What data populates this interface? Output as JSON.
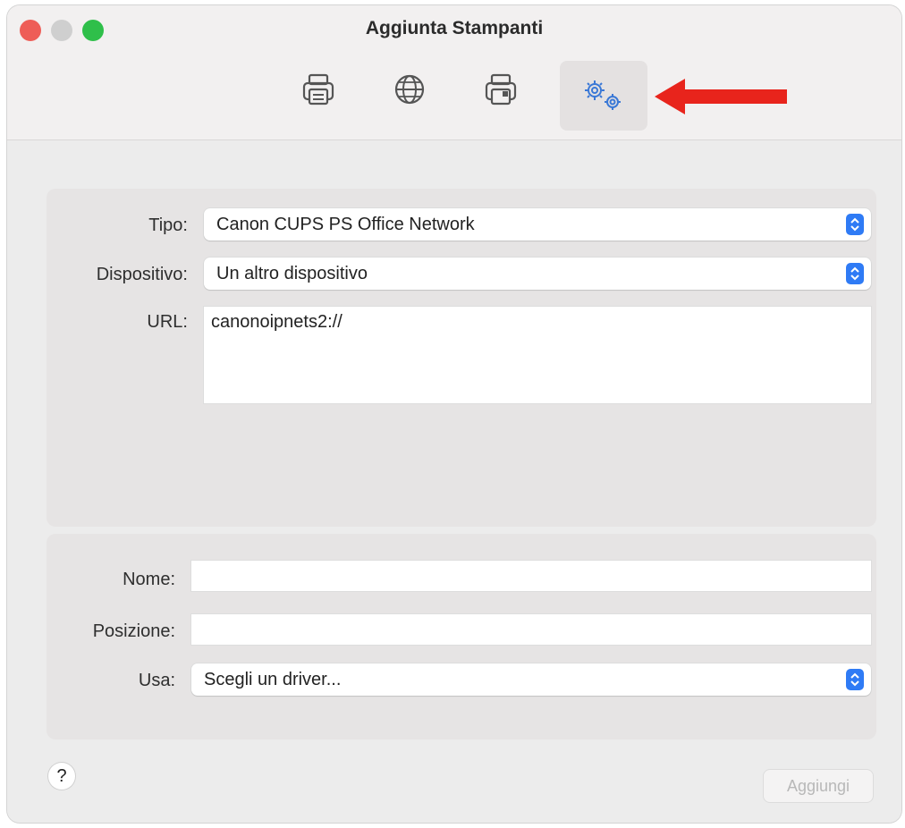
{
  "window": {
    "title": "Aggiunta Stampanti"
  },
  "toolbar": {
    "items": [
      {
        "icon": "printer-icon"
      },
      {
        "icon": "globe-icon"
      },
      {
        "icon": "windows-printer-icon"
      },
      {
        "icon": "gears-icon"
      }
    ],
    "arrow_color": "#e8241c"
  },
  "form": {
    "tipo": {
      "label": "Tipo:",
      "value": "Canon CUPS PS Office Network"
    },
    "dispositivo": {
      "label": "Dispositivo:",
      "value": "Un altro dispositivo"
    },
    "url": {
      "label": "URL:",
      "value": "canonoipnets2://"
    },
    "nome": {
      "label": "Nome:",
      "value": ""
    },
    "posizione": {
      "label": "Posizione:",
      "value": ""
    },
    "usa": {
      "label": "Usa:",
      "value": "Scegli un driver..."
    }
  },
  "footer": {
    "help_label": "?",
    "add_label": "Aggiungi"
  },
  "colors": {
    "accent": "#2f7bf5",
    "icon_blue": "#3a78d6"
  }
}
